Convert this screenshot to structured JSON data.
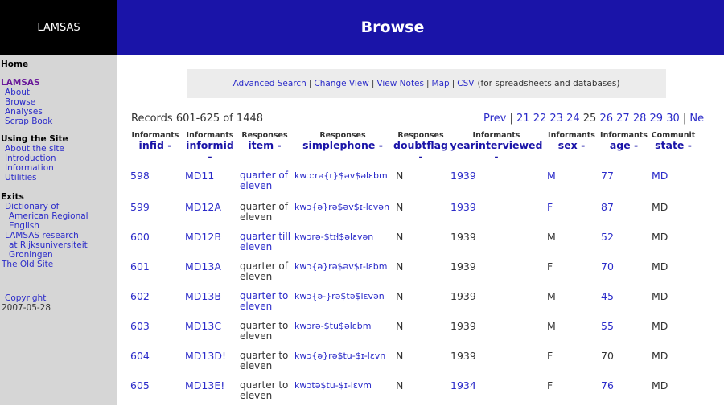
{
  "logo": "LAMSAS",
  "banner_title": "Browse",
  "sidebar": {
    "home": "Home",
    "lamsas": "LAMSAS",
    "lamsas_items": [
      "About",
      "Browse",
      "Analyses",
      "Scrap Book"
    ],
    "using": "Using the Site",
    "using_items": [
      "About the site",
      "Introduction",
      "Information",
      "Utilities"
    ],
    "exits": "Exits",
    "exits_items": [
      "Dictionary of",
      "American Regional",
      "English",
      "LAMSAS research",
      "at Rijksuniversiteit",
      "Groningen",
      "The Old Site"
    ],
    "copyright": "Copyright",
    "date": "2007-05-28"
  },
  "advbox": {
    "links": [
      "Advanced Search",
      "Change View",
      "View Notes",
      "Map",
      "CSV"
    ],
    "csv_note": "(for spreadsheets and databases)"
  },
  "records_text": "Records 601-625 of 1448",
  "pager": {
    "prev": "Prev",
    "pages": [
      "21",
      "22",
      "23",
      "24",
      "25",
      "26",
      "27",
      "28",
      "29",
      "30"
    ],
    "next": "Ne"
  },
  "columns": [
    {
      "group": "Informants",
      "name": "infid -"
    },
    {
      "group": "Informants",
      "name": "informid -"
    },
    {
      "group": "Responses",
      "name": "item -"
    },
    {
      "group": "Responses",
      "name": "simplephone -"
    },
    {
      "group": "Responses",
      "name": "doubtflag -"
    },
    {
      "group": "Informants",
      "name": "yearinterviewed -"
    },
    {
      "group": "Informants",
      "name": "sex -"
    },
    {
      "group": "Informants",
      "name": "age -"
    },
    {
      "group": "Communit",
      "name": "state -"
    }
  ],
  "rows": [
    [
      "598",
      "MD11",
      "quarter of eleven",
      "kwɔ:rə{r}$əv$əlɛbm",
      "N",
      "1939",
      "M",
      "77",
      "MD"
    ],
    [
      "599",
      "MD12A",
      "quarter of eleven",
      "kwɔ{ə}rə$əv$ɪ-lɛvən",
      "N",
      "1939",
      "F",
      "87",
      "MD"
    ],
    [
      "600",
      "MD12B",
      "quarter till eleven",
      "kwɔrə-$tɪł$əlɛvən",
      "N",
      "1939",
      "M",
      "52",
      "MD"
    ],
    [
      "601",
      "MD13A",
      "quarter of eleven",
      "kwɔ{ə}rə$əv$ɪ-lɛbm",
      "N",
      "1939",
      "F",
      "70",
      "MD"
    ],
    [
      "602",
      "MD13B",
      "quarter to eleven",
      "kwɔ{ə-}rə$tə$lɛvən",
      "N",
      "1939",
      "M",
      "45",
      "MD"
    ],
    [
      "603",
      "MD13C",
      "quarter to eleven",
      "kwɔrə-$tu$əlɛbm",
      "N",
      "1939",
      "M",
      "55",
      "MD"
    ],
    [
      "604",
      "MD13D!",
      "quarter to eleven",
      "kwɔ{ə}rə$tu-$ɪ-lɛvn",
      "N",
      "1939",
      "F",
      "70",
      "MD"
    ],
    [
      "605",
      "MD13E!",
      "quarter to eleven",
      "kwɔtə$tu-$ɪ-lɛvm",
      "N",
      "1934",
      "F",
      "76",
      "MD"
    ]
  ]
}
